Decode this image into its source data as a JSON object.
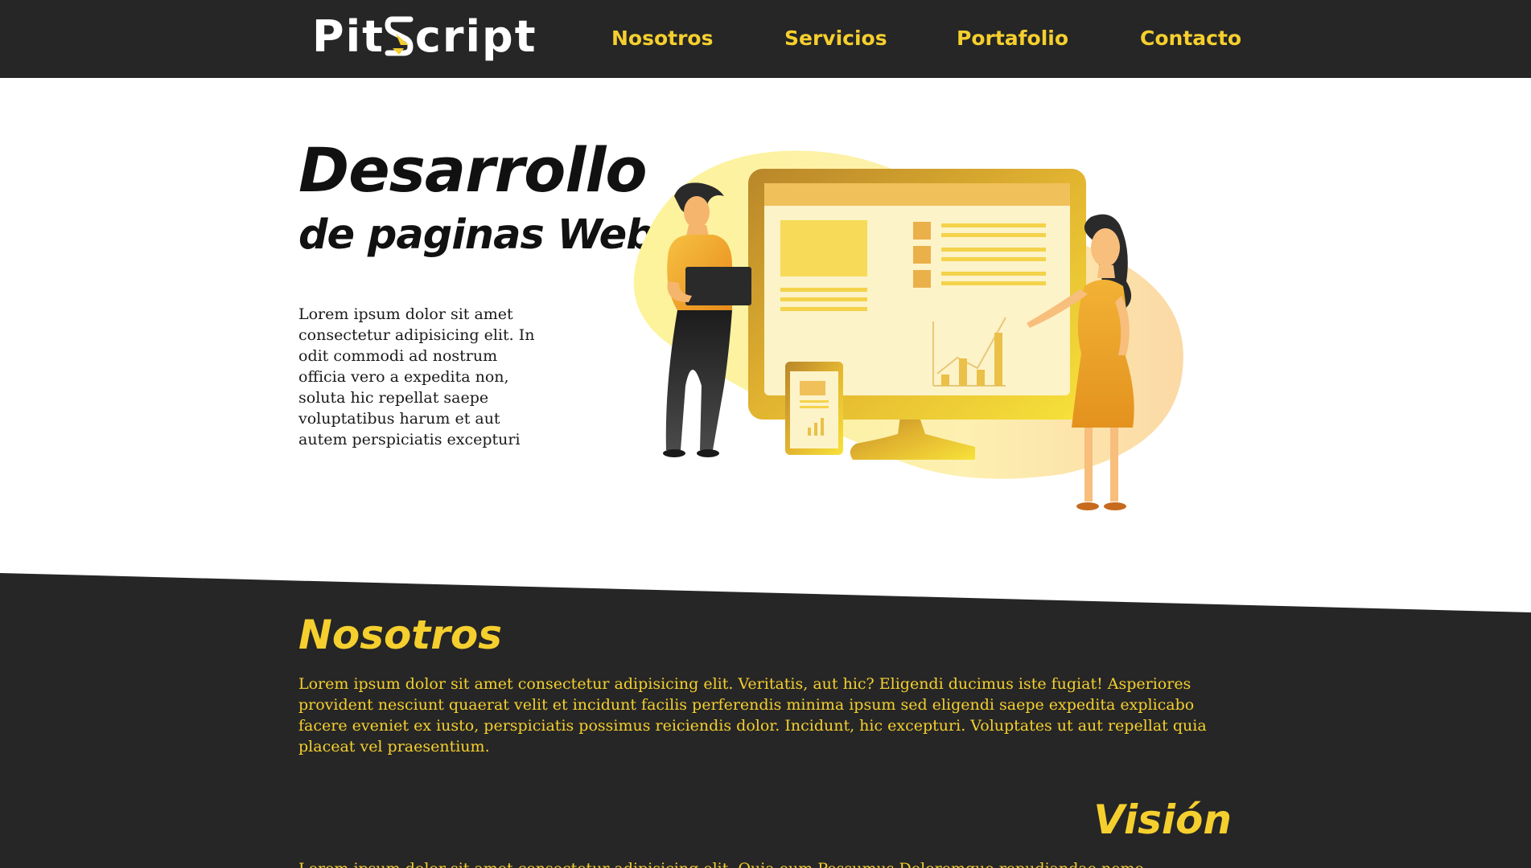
{
  "brand": {
    "name_part1": "Pit",
    "name_part2": "cript",
    "accent": "#f5cf2e",
    "dark": "#262626"
  },
  "nav": {
    "items": [
      {
        "label": "Nosotros"
      },
      {
        "label": "Servicios"
      },
      {
        "label": "Portafolio"
      },
      {
        "label": "Contacto"
      }
    ]
  },
  "hero": {
    "title": "Desarrollo",
    "subtitle": "de paginas Web",
    "text": "Lorem ipsum dolor sit amet consectetur adipisicing elit. In odit commodi ad nostrum officia vero a expedita non, soluta hic repellat saepe voluptatibus harum et aut autem perspiciatis excepturi",
    "illustration_icon": "web-development-illustration"
  },
  "about": {
    "title": "Nosotros",
    "text": "Lorem ipsum dolor sit amet consectetur adipisicing elit. Veritatis, aut hic? Eligendi ducimus iste fugiat! Asperiores provident nesciunt quaerat velit et incidunt facilis perferendis minima ipsum sed eligendi saepe expedita explicabo facere eveniet ex iusto, perspiciatis possimus reiciendis dolor. Incidunt, hic excepturi. Voluptates ut aut repellat quia placeat vel praesentium."
  },
  "vision": {
    "title": "Visión",
    "text": "Lorem ipsum dolor sit amet consectetur adipisicing elit. Quia eum Possumus Doloremque repudiandae nemo"
  }
}
